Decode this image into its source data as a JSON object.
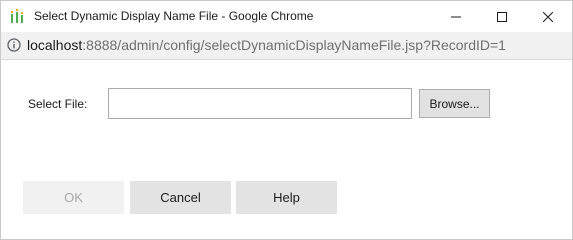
{
  "window": {
    "title": "Select Dynamic Display Name File - Google Chrome",
    "icon": "app-bars-icon"
  },
  "controls": {
    "minimize_icon": "minimize-icon",
    "maximize_icon": "maximize-icon",
    "close_icon": "close-icon"
  },
  "address": {
    "info_icon": "info-icon",
    "host": "localhost",
    "rest": ":8888/admin/config/selectDynamicDisplayNameFile.jsp?RecordID=1"
  },
  "form": {
    "select_file_label": "Select File:",
    "file_value": "",
    "browse_label": "Browse..."
  },
  "buttons": {
    "ok_label": "OK",
    "ok_enabled": false,
    "cancel_label": "Cancel",
    "help_label": "Help"
  },
  "colors": {
    "title_icon_green": "#4caf50",
    "title_icon_orange": "#f5a623",
    "button_bg": "#e3e3e3",
    "disabled_text": "#a8a8a8"
  }
}
